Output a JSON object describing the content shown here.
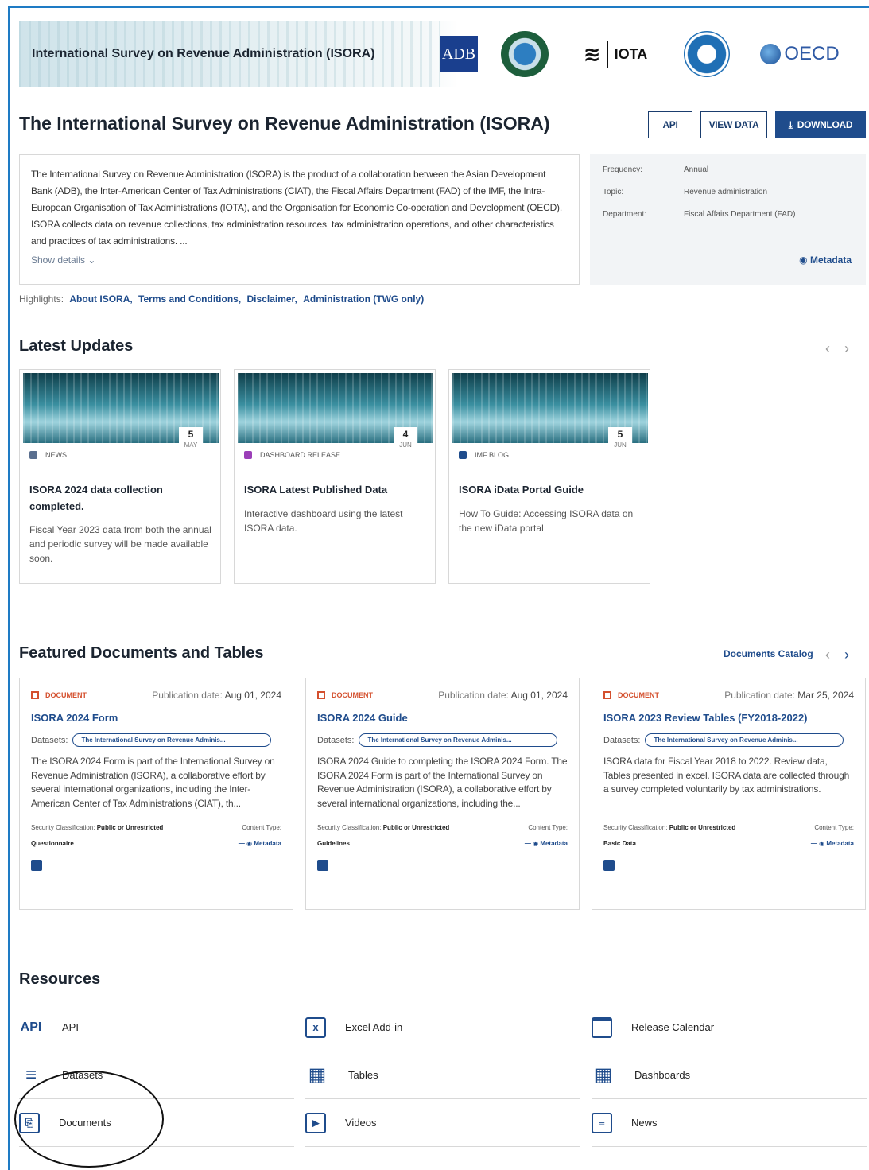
{
  "banner": {
    "title": "International Survey on Revenue Administration (ISORA)",
    "logos": {
      "adb": "ADB",
      "ciat": "ciat-logo",
      "iota": "IOTA",
      "imf": "imf-seal",
      "oecd": "OECD"
    }
  },
  "header": {
    "title": "The International Survey on Revenue Administration (ISORA)",
    "api_label": "API",
    "view_data_label": "VIEW DATA",
    "download_label": "DOWNLOAD"
  },
  "description": {
    "text": "The International Survey on Revenue Administration (ISORA) is the product of a collaboration between the Asian Development Bank (ADB), the Inter-American Center of Tax Administrations (CIAT), the Fiscal Affairs Department (FAD) of the IMF, the Intra-European Organisation of Tax Administrations (IOTA), and the Organisation for Economic Co-operation and Development (OECD). ISORA collects data on revenue collections, tax administration resources, tax administration operations, and other characteristics and practices of tax administrations. ...",
    "show_details": "Show details"
  },
  "metadata_panel": {
    "rows": [
      {
        "key": "Frequency:",
        "value": "Annual"
      },
      {
        "key": "Topic:",
        "value": "Revenue administration"
      },
      {
        "key": "Department:",
        "value": "Fiscal Affairs Department (FAD)"
      }
    ],
    "link": "Metadata"
  },
  "highlights": {
    "label": "Highlights:",
    "links": [
      "About ISORA,",
      "Terms and Conditions,",
      "Disclaimer,",
      "Administration (TWG only)"
    ]
  },
  "latest_updates": {
    "title": "Latest Updates",
    "cards": [
      {
        "day": "5",
        "month": "MAY",
        "category": "NEWS",
        "cat_color": "#5a6f8f",
        "title": "ISORA 2024 data collection completed.",
        "desc": "Fiscal Year 2023 data from both the annual and periodic survey will be made available soon."
      },
      {
        "day": "4",
        "month": "JUN",
        "category": "DASHBOARD RELEASE",
        "cat_color": "#9b3fb8",
        "title": "ISORA Latest Published Data",
        "desc": "Interactive dashboard using the latest ISORA data."
      },
      {
        "day": "5",
        "month": "JUN",
        "category": "IMF BLOG",
        "cat_color": "#1f4c8c",
        "title": "ISORA iData Portal Guide",
        "desc": "How To Guide: Accessing ISORA data on the new iData portal"
      }
    ]
  },
  "featured": {
    "title": "Featured Documents and Tables",
    "catalog_link": "Documents Catalog",
    "cards": [
      {
        "type": "DOCUMENT",
        "date_label": "Publication date:",
        "date": "Aug 01, 2024",
        "title": "ISORA 2024 Form",
        "datasets_label": "Datasets:",
        "dataset": "The International Survey on Revenue Adminis...",
        "desc": "The ISORA 2024 Form is part of the International Survey on Revenue Administration (ISORA), a collaborative effort by several international organizations, including the Inter-American Center of Tax Administrations (CIAT), th...",
        "security_label": "Security Classification:",
        "security": "Public or Unrestricted",
        "content_label": "Content Type:",
        "content": "Questionnaire",
        "metadata": "Metadata"
      },
      {
        "type": "DOCUMENT",
        "date_label": "Publication date:",
        "date": "Aug 01, 2024",
        "title": "ISORA 2024 Guide",
        "datasets_label": "Datasets:",
        "dataset": "The International Survey on Revenue Adminis...",
        "desc": "ISORA 2024 Guide to completing the ISORA 2024 Form. The ISORA 2024 Form is part of the International Survey on Revenue Administration (ISORA), a collaborative effort by several international organizations, including the...",
        "security_label": "Security Classification:",
        "security": "Public or Unrestricted",
        "content_label": "Content Type:",
        "content": "Guidelines",
        "metadata": "Metadata"
      },
      {
        "type": "DOCUMENT",
        "date_label": "Publication date:",
        "date": "Mar 25, 2024",
        "title": "ISORA 2023 Review Tables (FY2018-2022)",
        "datasets_label": "Datasets:",
        "dataset": "The International Survey on Revenue Adminis...",
        "desc": "ISORA data for Fiscal Year 2018 to 2022. Review data, Tables presented in excel. ISORA data are collected through a survey completed voluntarily by tax administrations.",
        "security_label": "Security Classification:",
        "security": "Public or Unrestricted",
        "content_label": "Content Type:",
        "content": "Basic Data",
        "metadata": "Metadata"
      }
    ]
  },
  "resources": {
    "title": "Resources",
    "items": [
      {
        "label": "API",
        "icon": "api-icon"
      },
      {
        "label": "Excel Add-in",
        "icon": "excel-addin-icon"
      },
      {
        "label": "Release Calendar",
        "icon": "calendar-icon"
      },
      {
        "label": "Datasets",
        "icon": "database-icon"
      },
      {
        "label": "Tables",
        "icon": "table-icon"
      },
      {
        "label": "Dashboards",
        "icon": "dashboard-icon"
      },
      {
        "label": "Documents",
        "icon": "documents-icon"
      },
      {
        "label": "Videos",
        "icon": "video-icon"
      },
      {
        "label": "News",
        "icon": "news-icon"
      }
    ]
  }
}
